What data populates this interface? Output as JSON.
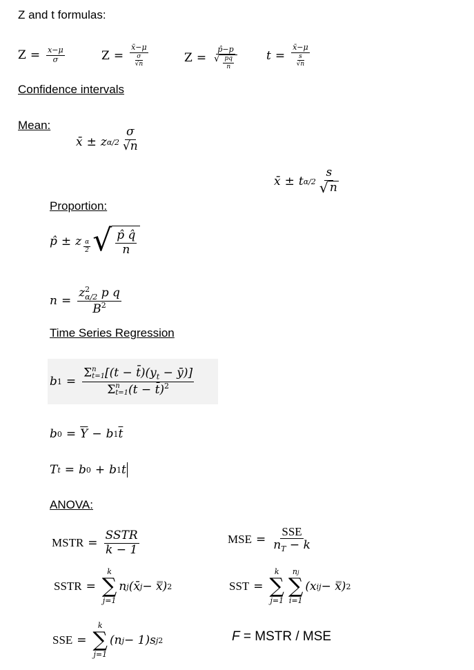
{
  "headings": {
    "z_and_t": "Z and t formulas:",
    "confidence": "Confidence intervals",
    "mean": "Mean:",
    "proportion": "Proportion:",
    "time_series": "Time Series Regression",
    "anova": "ANOVA:"
  },
  "formulas": {
    "z1": {
      "lhs": "Z",
      "eq": "=",
      "num": "x−μ",
      "den": "σ"
    },
    "z2": {
      "lhs": "Z",
      "eq": "=",
      "num": "x̄−μ",
      "den_num": "σ",
      "den_den": "n"
    },
    "z3": {
      "lhs": "Z",
      "eq": "=",
      "num": "p̂−p",
      "rad_num": "pq",
      "rad_den": "n"
    },
    "t1": {
      "lhs": "t",
      "eq": "=",
      "num": "x̄−μ",
      "den_num": "s",
      "den_den": "n"
    },
    "mean_z": {
      "xbar": "x̄",
      "pm": "±",
      "z": "z",
      "sub": "α/2",
      "num": "σ",
      "den": "n"
    },
    "mean_t": {
      "xbar": "x̄",
      "pm": "±",
      "t": "t",
      "sub": "α/2",
      "num": "s",
      "den": "n"
    },
    "prop": {
      "phat": "p̂",
      "pm": "±",
      "z": "z",
      "sub_num": "α",
      "sub_den": "2",
      "num": "p̂ q̂",
      "den": "n"
    },
    "sample_n": {
      "lhs": "n",
      "eq": "=",
      "z": "z",
      "sup": "2",
      "sub": "α/2",
      "rest": "p q",
      "den": "B",
      "den_sup": "2"
    },
    "b1": {
      "lhs": "b",
      "lhs_sub": "1",
      "eq": "=",
      "num": "Σ",
      "num_sup": "n",
      "num_sub": "t=1",
      "num_body": "[(t − t̄)(y",
      "num_body_sub": "t",
      "num_body_end": " − ȳ)]",
      "den": "Σ",
      "den_sup": "n",
      "den_sub": "t=1",
      "den_body": "(t − t̄)",
      "den_body_sup": "2"
    },
    "b0": {
      "lhs": "b",
      "lhs_sub": "0",
      "eq": "=",
      "y": "Y",
      "minus": "−",
      "b": "b",
      "b_sub": "1",
      "t": "t"
    },
    "tt": {
      "lhs": "T",
      "lhs_sub": "t",
      "eq": "=",
      "b0": "b",
      "b0_sub": "0",
      "plus": "+",
      "b1": "b",
      "b1_sub": "1",
      "t": "t"
    },
    "mstr": {
      "lhs": "MSTR",
      "eq": "=",
      "num": "SSTR",
      "den": "k − 1"
    },
    "mse": {
      "lhs": "MSE",
      "eq": "=",
      "num": "SSE",
      "den_n": "n",
      "den_sub": "T",
      "den_rest": " − k"
    },
    "sstr": {
      "lhs": "SSTR",
      "eq": "=",
      "sig_top": "k",
      "sig_bot": "j=1",
      "body": "n",
      "body_sub": "j",
      "paren": "(x̄",
      "paren_sub": "j",
      "paren_end": " − x̿)",
      "sup": "2"
    },
    "sst": {
      "lhs": "SST",
      "eq": "=",
      "sig1_top": "k",
      "sig1_bot": "j=1",
      "sig2_top": "n",
      "sig2_top_sub": "j",
      "sig2_bot": "i=1",
      "paren": "(x",
      "paren_sub": "ij",
      "paren_end": " − x̿)",
      "sup": "2"
    },
    "sse": {
      "lhs": "SSE",
      "eq": "=",
      "sig_top": "k",
      "sig_bot": "j=1",
      "body": "(n",
      "body_sub": "j",
      "body_mid": " − 1)s",
      "s_sub": "j",
      "sup": "2"
    },
    "f": {
      "f": "F",
      "rest": " = MSTR / MSE"
    }
  }
}
